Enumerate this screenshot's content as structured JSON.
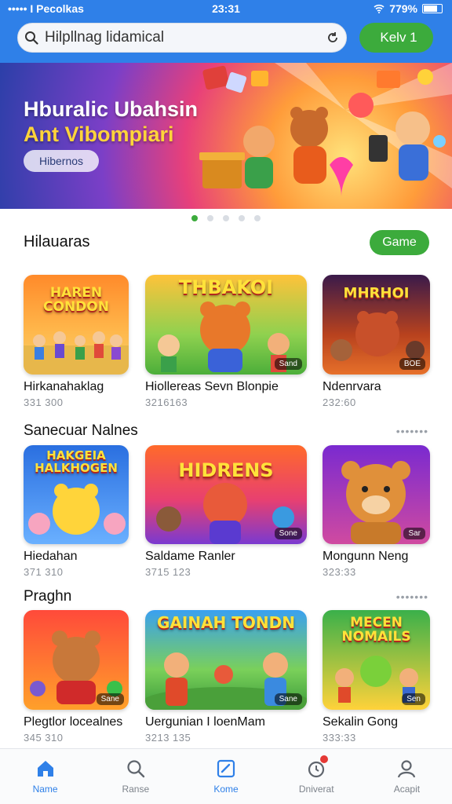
{
  "status_bar": {
    "carrier": "••••• I Pecolkas",
    "time": "23:31",
    "battery": "779%",
    "battery_level": 0.78
  },
  "search": {
    "query": "Hilpllnag lidamical",
    "placeholder": "Hilpllnag lidamical"
  },
  "key_button": {
    "label": "Kelv 1"
  },
  "banner": {
    "title_line1": "Hburalic Ubahsin",
    "title_line2": "Ant Vibompiari",
    "button_label": "Hibernos",
    "active_slide": 1,
    "slide_count": 5
  },
  "sections": [
    {
      "title": "Hilauaras",
      "action_label": "Game",
      "items": [
        {
          "name": "Hirkanahaklag",
          "sub": "331 300",
          "art_text": "HAREN CONDON",
          "badge": ""
        },
        {
          "name": "Hiollereas Sevn Blonpie",
          "sub": "3216163",
          "art_text": "THBAKOI",
          "badge": "Sand"
        },
        {
          "name": "Ndenrvara",
          "sub": "232:60",
          "art_text": "MHRHOI",
          "badge": "BOE"
        }
      ]
    },
    {
      "title": "Sanecuar Nalnes",
      "action_label": "•••••••",
      "items": [
        {
          "name": "Hiedahan",
          "sub": "371 310",
          "art_text": "HAKGEIA HALKHOGEN",
          "badge": ""
        },
        {
          "name": "Saldame Ranler",
          "sub": "3715 123",
          "art_text": "HIDRENS",
          "badge": "Sone"
        },
        {
          "name": "Mongunn Neng",
          "sub": "323:33",
          "art_text": "",
          "badge": "Sar"
        }
      ]
    },
    {
      "title": "Praghn",
      "action_label": "•••••••",
      "items": [
        {
          "name": "Plegtlor locealnes",
          "sub": "345 310",
          "art_text": "",
          "badge": "Sane"
        },
        {
          "name": "Uergunian I loenMam",
          "sub": "3213 135",
          "art_text": "GAINAH TONDN",
          "badge": "Sane"
        },
        {
          "name": "Sekalin Gong",
          "sub": "333:33",
          "art_text": "MECEN NOMAILS",
          "badge": "Sen"
        }
      ]
    }
  ],
  "bottom_nav": [
    {
      "label": "Name",
      "icon": "home-icon",
      "active": true
    },
    {
      "label": "Ranse",
      "icon": "search-icon",
      "active": false
    },
    {
      "label": "Kome",
      "icon": "square-icon",
      "active": false
    },
    {
      "label": "Dniverat",
      "icon": "bell-icon",
      "active": false,
      "badge": true
    },
    {
      "label": "Acapit",
      "icon": "person-icon",
      "active": false
    }
  ],
  "colors": {
    "primary": "#2f80e8",
    "accent_green": "#3cab3c",
    "title_yellow": "#ffd43a"
  }
}
